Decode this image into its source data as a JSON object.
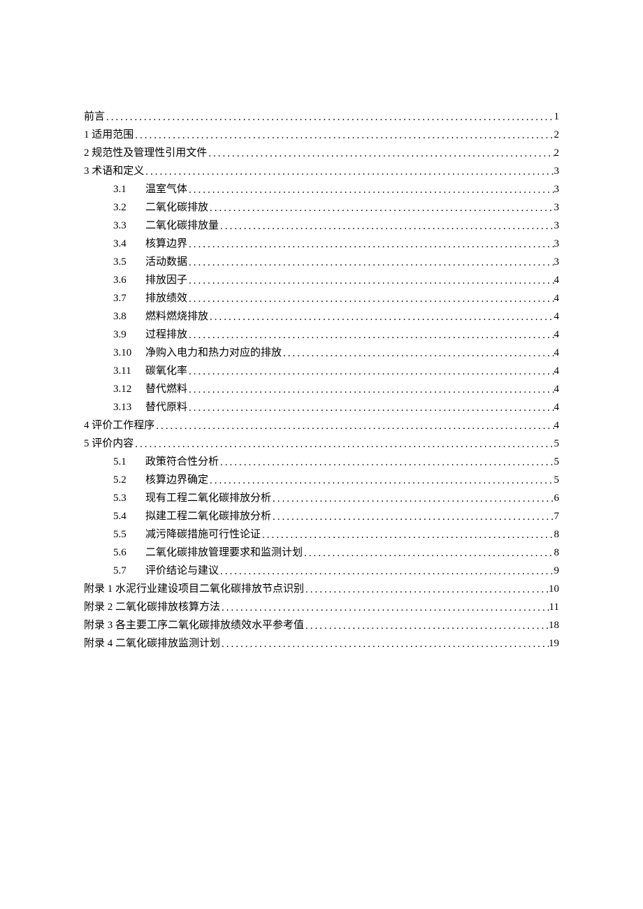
{
  "toc": [
    {
      "num": "",
      "text": "前言",
      "page": "1",
      "indent": false
    },
    {
      "num": "",
      "text": "1 适用范围",
      "page": "2",
      "indent": false
    },
    {
      "num": "",
      "text": "2 规范性及管理性引用文件",
      "page": "2",
      "indent": false
    },
    {
      "num": "",
      "text": "3 术语和定义",
      "page": "3",
      "indent": false
    },
    {
      "num": "3.1",
      "text": "温室气体",
      "page": "3",
      "indent": true
    },
    {
      "num": "3.2",
      "text": "二氧化碳排放",
      "page": "3",
      "indent": true
    },
    {
      "num": "3.3",
      "text": "二氧化碳排放量",
      "page": "3",
      "indent": true
    },
    {
      "num": "3.4",
      "text": "核算边界",
      "page": "3",
      "indent": true
    },
    {
      "num": "3.5",
      "text": "活动数据",
      "page": "3",
      "indent": true
    },
    {
      "num": "3.6",
      "text": "排放因子",
      "page": "4",
      "indent": true
    },
    {
      "num": "3.7",
      "text": "排放绩效",
      "page": "4",
      "indent": true
    },
    {
      "num": "3.8",
      "text": "燃料燃烧排放",
      "page": "4",
      "indent": true
    },
    {
      "num": "3.9",
      "text": "过程排放",
      "page": "4",
      "indent": true
    },
    {
      "num": "3.10",
      "text": "净购入电力和热力对应的排放",
      "page": "4",
      "indent": true
    },
    {
      "num": "3.11",
      "text": "碳氧化率",
      "page": "4",
      "indent": true
    },
    {
      "num": "3.12",
      "text": "替代燃料",
      "page": "4",
      "indent": true
    },
    {
      "num": "3.13",
      "text": "替代原料",
      "page": "4",
      "indent": true
    },
    {
      "num": "",
      "text": "4 评价工作程序",
      "page": "4",
      "indent": false
    },
    {
      "num": "",
      "text": "5 评价内容",
      "page": "5",
      "indent": false
    },
    {
      "num": "5.1",
      "text": "政策符合性分析",
      "page": "5",
      "indent": true
    },
    {
      "num": "5.2",
      "text": "核算边界确定",
      "page": "5",
      "indent": true
    },
    {
      "num": "5.3",
      "text": "现有工程二氧化碳排放分析",
      "page": "6",
      "indent": true
    },
    {
      "num": "5.4",
      "text": "拟建工程二氧化碳排放分析",
      "page": "7",
      "indent": true
    },
    {
      "num": "5.5",
      "text": "减污降碳措施可行性论证",
      "page": "8",
      "indent": true
    },
    {
      "num": "5.6",
      "text": "二氧化碳排放管理要求和监测计划",
      "page": "8",
      "indent": true
    },
    {
      "num": "5.7",
      "text": "评价结论与建议",
      "page": "9",
      "indent": true
    },
    {
      "num": "",
      "text": "附录 1 水泥行业建设项目二氧化碳排放节点识别",
      "page": "10",
      "indent": false
    },
    {
      "num": "",
      "text": "附录 2 二氧化碳排放核算方法",
      "page": "11",
      "indent": false
    },
    {
      "num": "",
      "text": "附录 3 各主要工序二氧化碳排放绩效水平参考值",
      "page": "18",
      "indent": false
    },
    {
      "num": "",
      "text": "附录 4 二氧化碳排放监测计划",
      "page": "19",
      "indent": false
    }
  ]
}
